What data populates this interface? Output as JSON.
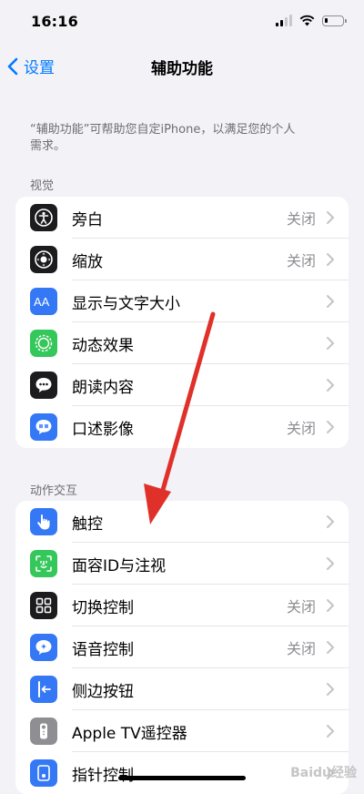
{
  "status": {
    "time": "16:16"
  },
  "nav": {
    "back_label": "设置",
    "title": "辅助功能"
  },
  "description": "“辅助功能”可帮助您自定iPhone，以满足您的个人需求。",
  "sections": [
    {
      "header": "视觉",
      "items": [
        {
          "label": "旁白",
          "value": "关闭",
          "icon": "voiceover-icon",
          "color": "#1c1c1e"
        },
        {
          "label": "缩放",
          "value": "关闭",
          "icon": "zoom-icon",
          "color": "#1c1c1e"
        },
        {
          "label": "显示与文字大小",
          "value": "",
          "icon": "text-size-icon",
          "color": "#3478f6"
        },
        {
          "label": "动态效果",
          "value": "",
          "icon": "motion-icon",
          "color": "#34c759"
        },
        {
          "label": "朗读内容",
          "value": "",
          "icon": "spoken-content-icon",
          "color": "#1c1c1e"
        },
        {
          "label": "口述影像",
          "value": "关闭",
          "icon": "audio-description-icon",
          "color": "#3478f6"
        }
      ]
    },
    {
      "header": "动作交互",
      "items": [
        {
          "label": "触控",
          "value": "",
          "icon": "touch-icon",
          "color": "#3478f6"
        },
        {
          "label": "面容ID与注视",
          "value": "",
          "icon": "face-id-icon",
          "color": "#34c759"
        },
        {
          "label": "切换控制",
          "value": "关闭",
          "icon": "switch-control-icon",
          "color": "#1c1c1e"
        },
        {
          "label": "语音控制",
          "value": "关闭",
          "icon": "voice-control-icon",
          "color": "#3478f6"
        },
        {
          "label": "侧边按钮",
          "value": "",
          "icon": "side-button-icon",
          "color": "#3478f6"
        },
        {
          "label": "Apple TV遥控器",
          "value": "",
          "icon": "apple-tv-remote-icon",
          "color": "#8e8e93"
        },
        {
          "label": "指针控制",
          "value": "",
          "icon": "pointer-control-icon",
          "color": "#3478f6"
        }
      ]
    }
  ],
  "watermark": "Baidu经验"
}
